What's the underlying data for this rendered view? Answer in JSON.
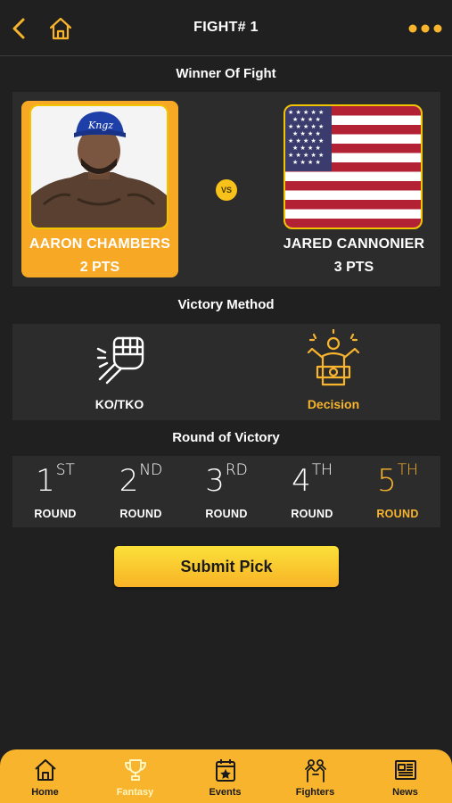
{
  "header": {
    "title": "FIGHT# 1",
    "back_icon": "chevron-left-icon",
    "home_icon": "home-icon",
    "more_icon": "more-horizontal-icon"
  },
  "winner": {
    "section_title": "Winner Of Fight",
    "vs_label": "VS",
    "fighters": [
      {
        "name": "AARON CHAMBERS",
        "points": "2 PTS",
        "selected": true,
        "image": "fighter-photo"
      },
      {
        "name": "JARED CANNONIER",
        "points": "3 PTS",
        "selected": false,
        "image": "us-flag"
      }
    ]
  },
  "victory_method": {
    "section_title": "Victory Method",
    "options": [
      {
        "label": "KO/TKO",
        "icon": "fist-icon",
        "selected": false
      },
      {
        "label": "Decision",
        "icon": "champion-belt-icon",
        "selected": true
      }
    ]
  },
  "round_of_victory": {
    "section_title": "Round of Victory",
    "rounds": [
      {
        "number": "1",
        "suffix": "ST",
        "label": "ROUND",
        "selected": false
      },
      {
        "number": "2",
        "suffix": "ND",
        "label": "ROUND",
        "selected": false
      },
      {
        "number": "3",
        "suffix": "RD",
        "label": "ROUND",
        "selected": false
      },
      {
        "number": "4",
        "suffix": "TH",
        "label": "ROUND",
        "selected": false
      },
      {
        "number": "5",
        "suffix": "TH",
        "label": "ROUND",
        "selected": true
      }
    ]
  },
  "submit_label": "Submit Pick",
  "tabs": [
    {
      "label": "Home",
      "icon": "home-icon",
      "active": false
    },
    {
      "label": "Fantasy",
      "icon": "trophy-icon",
      "active": true
    },
    {
      "label": "Events",
      "icon": "calendar-icon",
      "active": false
    },
    {
      "label": "Fighters",
      "icon": "fighters-icon",
      "active": false
    },
    {
      "label": "News",
      "icon": "newspaper-icon",
      "active": false
    }
  ],
  "colors": {
    "accent": "#f7b42c",
    "background": "#202020",
    "panel": "#2c2c2c"
  }
}
